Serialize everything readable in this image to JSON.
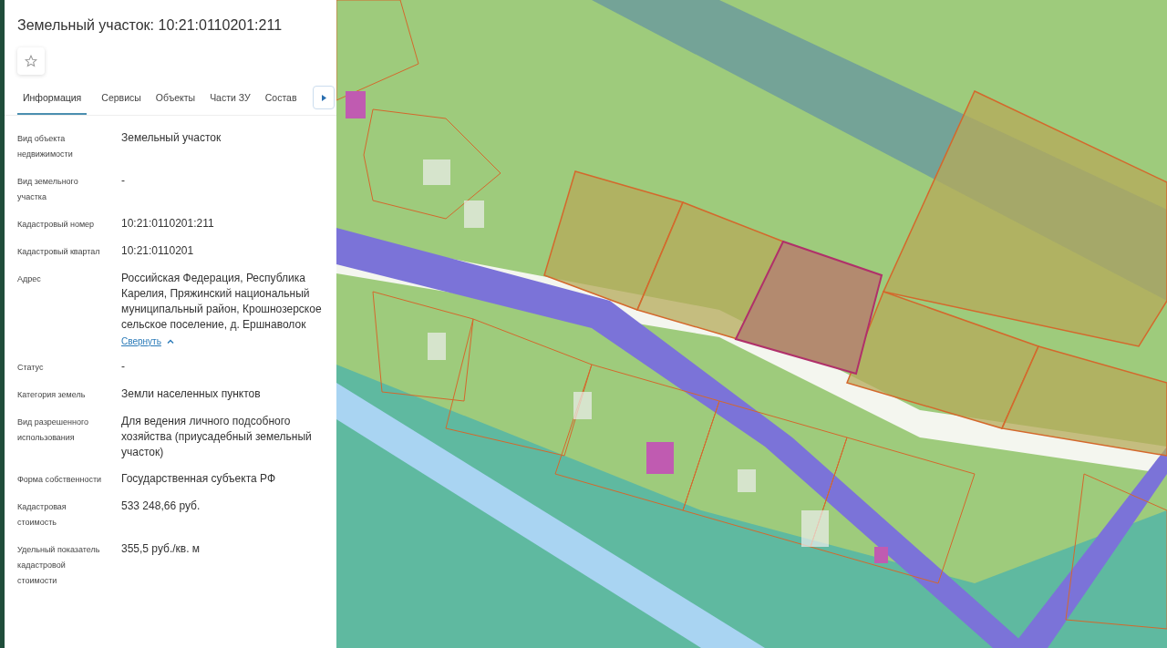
{
  "panel": {
    "title": "Земельный участок: 10:21:0110201:211",
    "favorite": false,
    "tabs": [
      {
        "label": "Информация",
        "selected": true
      },
      {
        "label": "Сервисы",
        "selected": false
      },
      {
        "label": "Объекты",
        "selected": false
      },
      {
        "label": "Части ЗУ",
        "selected": false
      },
      {
        "label": "Состав",
        "selected": false
      }
    ],
    "fields": [
      {
        "label": "Вид объекта недвижимости",
        "value": "Земельный участок"
      },
      {
        "label": "Вид земельного участка",
        "value": "-"
      },
      {
        "label": "Кадастровый номер",
        "value": "10:21:0110201:211"
      },
      {
        "label": "Кадастровый квартал",
        "value": "10:21:0110201"
      },
      {
        "label": "Адрес",
        "value": "Российская Федерация, Республика Карелия, Пряжинский национальный муниципальный район, Крошнозерское сельское поселение, д. Ершнаволок",
        "link": "Свернуть"
      },
      {
        "label": "Статус",
        "value": "-"
      },
      {
        "label": "Категория земель",
        "value": "Земли населенных пунктов"
      },
      {
        "label": "Вид разрешенного использования",
        "value": "Для ведения личного подсобного хозяйства (приусадебный земельный участок)"
      },
      {
        "label": "Форма собственности",
        "value": "Государственная субъекта РФ"
      },
      {
        "label": "Кадастровая стоимость",
        "value": "533 248,66 руб."
      },
      {
        "label": "Удельный показатель кадастровой стоимости",
        "value": "355,5 руб./кв. м"
      }
    ]
  }
}
